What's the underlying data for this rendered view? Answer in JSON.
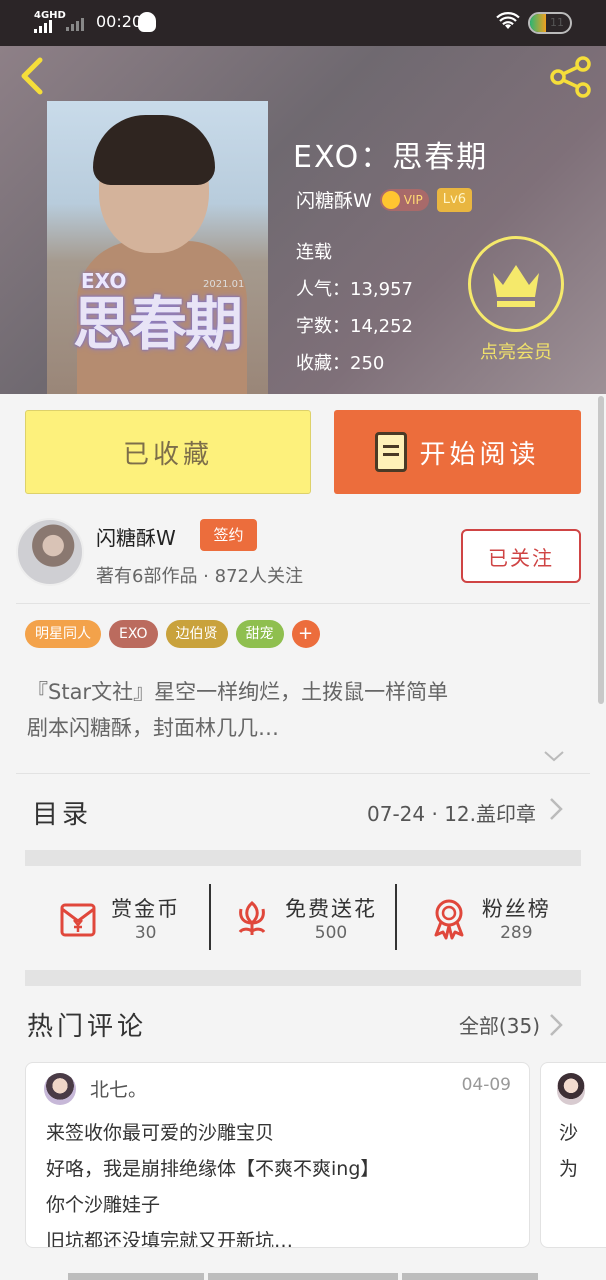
{
  "status_bar": {
    "network": "4GHD",
    "time": "00:20",
    "battery_level": "11"
  },
  "book": {
    "title": "EXO：思春期",
    "cover_exo": "EXO",
    "cover_title": "思春期",
    "cover_date": "2021.01",
    "author": "闪糖酥W",
    "vip_label": "VIP",
    "level": "Lv6",
    "status": "连载",
    "popularity": "人气：13,957",
    "words": "字数：14,252",
    "favorites": "收藏：250"
  },
  "member": {
    "label": "点亮会员"
  },
  "actions": {
    "collected_label": "已收藏",
    "read_label": "开始阅读"
  },
  "author_panel": {
    "name": "闪糖酥W",
    "sign_badge": "签约",
    "meta": "著有6部作品 · 872人关注",
    "follow_label": "已关注"
  },
  "tags": [
    {
      "label": "明星同人",
      "color": "#f3a24a"
    },
    {
      "label": "EXO",
      "color": "#bb6b5e"
    },
    {
      "label": "边伯贤",
      "color": "#c9a23c"
    },
    {
      "label": "甜宠",
      "color": "#8fbf4f"
    }
  ],
  "tag_add": "+",
  "synopsis": {
    "line1": "『Star文社』星空一样绚烂，土拨鼠一样简单",
    "line2": "剧本闪糖酥，封面林几几…"
  },
  "toc": {
    "label": "目录",
    "latest": "07-24 · 12.盖印章"
  },
  "stats": [
    {
      "title": "赏金币",
      "value": "30",
      "icon": "red-envelope-icon"
    },
    {
      "title": "免费送花",
      "value": "500",
      "icon": "flower-icon"
    },
    {
      "title": "粉丝榜",
      "value": "289",
      "icon": "award-ribbon-icon"
    }
  ],
  "comments_section": {
    "title": "热门评论",
    "all_label": "全部(35)"
  },
  "comments": [
    {
      "name": "北七。",
      "date": "04-09",
      "lines": [
        "来签收你最可爱的沙雕宝贝",
        "好咯，我是崩排绝缘体【不爽不爽ing】",
        "你个沙雕娃子",
        "旧坑都还没填完就又开新坑…"
      ]
    },
    {
      "lines": [
        "沙",
        "为"
      ]
    }
  ],
  "colors": {
    "accent": "#ec6d3c",
    "collected_bg": "#fdf17c",
    "follow_red": "#cf4444",
    "member_gold": "#f5e96b"
  }
}
